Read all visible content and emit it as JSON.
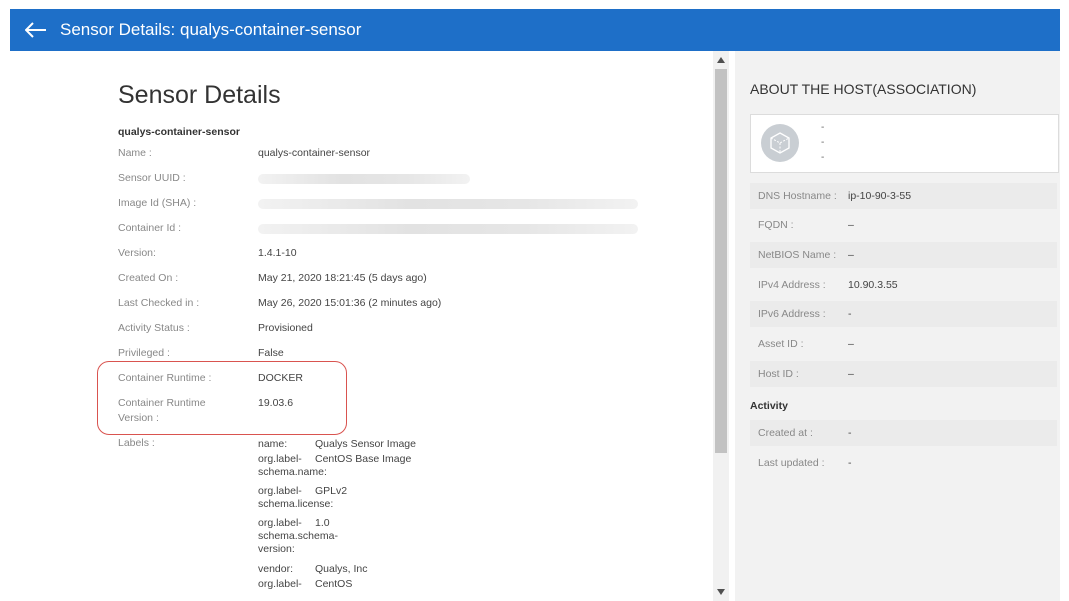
{
  "header": {
    "title": "Sensor Details: qualys-container-sensor"
  },
  "left": {
    "page_title": "Sensor Details",
    "sensor_name": "qualys-container-sensor",
    "fields": {
      "name": {
        "label": "Name :",
        "value": "qualys-container-sensor"
      },
      "uuid": {
        "label": "Sensor UUID :"
      },
      "image_id": {
        "label": "Image Id (SHA) :"
      },
      "container_id": {
        "label": "Container Id :"
      },
      "version": {
        "label": "Version:",
        "value": "1.4.1-10"
      },
      "created_on": {
        "label": "Created On :",
        "value": "May 21, 2020 18:21:45 (5 days ago)"
      },
      "last_checked": {
        "label": "Last Checked in :",
        "value": "May 26, 2020 15:01:36 (2 minutes ago)"
      },
      "activity_status": {
        "label": "Activity Status :",
        "value": "Provisioned"
      },
      "privileged": {
        "label": "Privileged :",
        "value": "False"
      },
      "runtime": {
        "label": "Container Runtime :",
        "value": "DOCKER"
      },
      "runtime_version": {
        "label_line1": "Container Runtime",
        "label_line2": "Version :",
        "value": "19.03.6"
      },
      "labels": {
        "label": "Labels :"
      }
    },
    "labels": [
      {
        "key": [
          "name:"
        ],
        "value": "Qualys Sensor Image"
      },
      {
        "key": [
          "org.label-",
          "schema.name:"
        ],
        "value": "CentOS Base Image"
      },
      {
        "key": [
          "org.label-",
          "schema.license:"
        ],
        "value": "GPLv2"
      },
      {
        "key": [
          "org.label-",
          "schema.schema-",
          "version:"
        ],
        "value": "1.0"
      },
      {
        "key": [
          "vendor:"
        ],
        "value": "Qualys, Inc"
      },
      {
        "key": [
          "org.label-"
        ],
        "value": "CentOS"
      }
    ]
  },
  "right": {
    "title": "ABOUT THE HOST(ASSOCIATION)",
    "host_lines": [
      "-",
      "-",
      "-"
    ],
    "rows": [
      {
        "label": "DNS Hostname :",
        "value": "ip-10-90-3-55"
      },
      {
        "label": "FQDN :",
        "value": "–"
      },
      {
        "label": "NetBIOS Name :",
        "value": "–"
      },
      {
        "label": "IPv4 Address :",
        "value": "10.90.3.55"
      },
      {
        "label": "IPv6 Address :",
        "value": "-"
      },
      {
        "label": "Asset ID :",
        "value": "–"
      },
      {
        "label": "Host ID :",
        "value": "–"
      }
    ],
    "activity_title": "Activity",
    "activity_rows": [
      {
        "label": "Created at :",
        "value": "-"
      },
      {
        "label": "Last updated :",
        "value": "-"
      }
    ]
  },
  "colors": {
    "header_bg": "#1e6fc8",
    "highlight": "#d9534f"
  },
  "icons": {
    "back": "left-arrow-icon",
    "host": "cube-icon"
  }
}
